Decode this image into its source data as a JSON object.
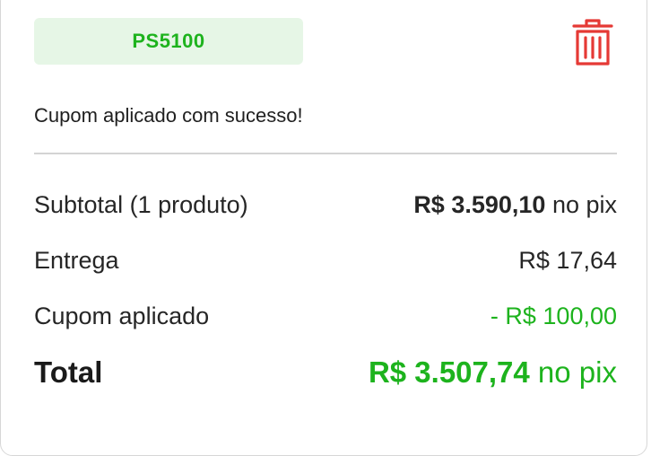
{
  "coupon": {
    "code": "PS5100",
    "success_message": "Cupom aplicado com sucesso!"
  },
  "summary": {
    "subtotal_label": "Subtotal (1 produto)",
    "subtotal_amount": "R$ 3.590,10",
    "subtotal_suffix": " no pix",
    "delivery_label": "Entrega",
    "delivery_amount": "R$ 17,64",
    "coupon_label": "Cupom aplicado",
    "coupon_discount": "- R$ 100,00",
    "total_label": "Total",
    "total_amount": "R$ 3.507,74",
    "total_suffix": " no pix"
  },
  "icons": {
    "remove": "trash-icon"
  },
  "colors": {
    "accent_green": "#1db31d",
    "pill_background": "#e6f6e6",
    "trash_red": "#e53935"
  }
}
